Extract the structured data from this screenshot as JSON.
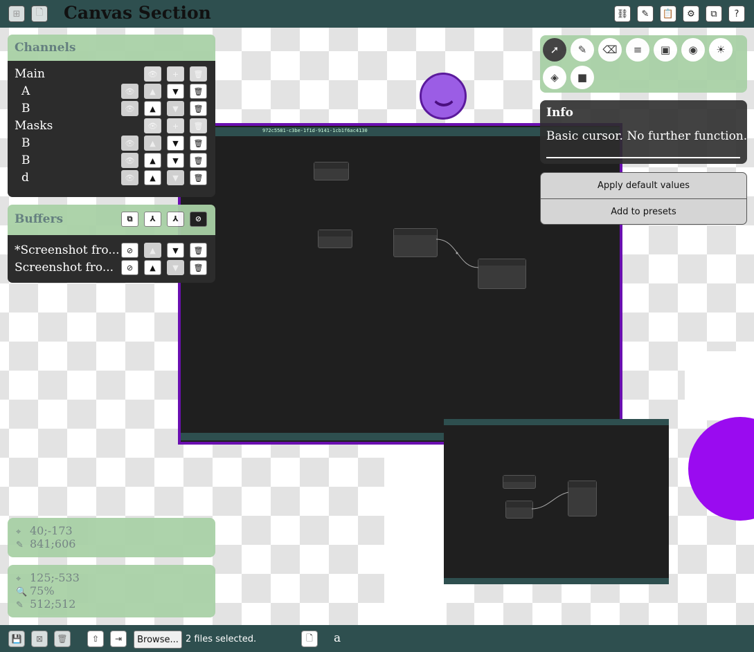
{
  "header": {
    "title": "Canvas Section",
    "left_buttons": [
      {
        "icon": "new-canvas-icon",
        "glyph": "⊞"
      },
      {
        "icon": "new-file-icon",
        "glyph": "🗋"
      }
    ],
    "right_buttons": [
      {
        "icon": "node-graph-icon",
        "glyph": "⛓"
      },
      {
        "icon": "edit-icon",
        "glyph": "✎"
      },
      {
        "icon": "clipboard-settings-icon",
        "glyph": "📋"
      },
      {
        "icon": "gear-icon",
        "glyph": "⚙"
      },
      {
        "icon": "copy-document-icon",
        "glyph": "⧉"
      },
      {
        "icon": "help-icon",
        "glyph": "?"
      }
    ]
  },
  "channels": {
    "title": "Channels",
    "rows": [
      {
        "label": "Main",
        "indent": false
      },
      {
        "label": "A",
        "indent": true
      },
      {
        "label": "B",
        "indent": true
      },
      {
        "label": "Masks",
        "indent": false
      },
      {
        "label": "B",
        "indent": true
      },
      {
        "label": "B",
        "indent": true
      },
      {
        "label": "d",
        "indent": true
      }
    ]
  },
  "buffers": {
    "title": "Buffers",
    "rows": [
      {
        "label": "*Screenshot fro..."
      },
      {
        "label": "Screenshot fro..."
      }
    ]
  },
  "tools": {
    "items": [
      {
        "icon": "cursor-icon",
        "glyph": "➚",
        "active": true
      },
      {
        "icon": "brush-icon",
        "glyph": "✎",
        "active": false
      },
      {
        "icon": "eraser-icon",
        "glyph": "⌫",
        "active": false
      },
      {
        "icon": "text-icon",
        "glyph": "≡",
        "active": false
      },
      {
        "icon": "image-icon",
        "glyph": "▣",
        "active": false
      },
      {
        "icon": "camera-icon",
        "glyph": "◉",
        "active": false
      },
      {
        "icon": "brightness-icon",
        "glyph": "☀",
        "active": false
      },
      {
        "icon": "fill-icon",
        "glyph": "◈",
        "active": false
      },
      {
        "icon": "screenshot-icon",
        "glyph": "■",
        "active": false
      }
    ]
  },
  "info": {
    "title": "Info",
    "text": "Basic cursor. No further function."
  },
  "actions": {
    "apply_label": "Apply default values",
    "presets_label": "Add to presets"
  },
  "status_cursor": {
    "cursor_pos": "40;-173",
    "pen_pos": "841;606"
  },
  "status_view": {
    "offset": "125;-533",
    "zoom": "75%",
    "size": "512;512"
  },
  "screenshot": {
    "tab_text": "972c5581-c3be-1f1d-9141-1cb1f6ac4130"
  },
  "footer": {
    "browse_label": "Browse...",
    "files_selected": "2 files selected.",
    "trailing_text": "a"
  },
  "colors": {
    "bar": "#2e4f4f",
    "panel_green": "#a9d1a6",
    "panel_dark": "#2c2c2c",
    "accent_purple": "#9a0bf0"
  }
}
